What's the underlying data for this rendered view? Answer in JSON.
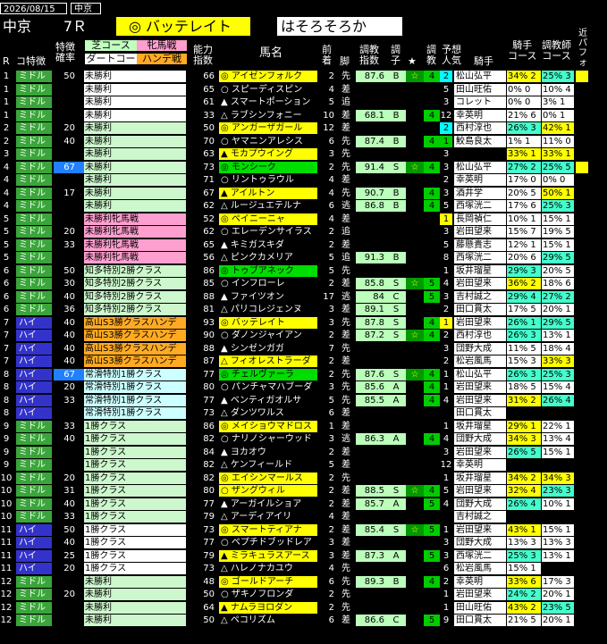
{
  "topbar": {
    "date": "2026/08/15",
    "venue": "中京"
  },
  "header": {
    "venue": "中京",
    "race": "7Ｒ",
    "pick_mark": "◎ バッテレイト",
    "comment": "はそろそろか"
  },
  "columns": {
    "r": "R",
    "dist": "コ特徴",
    "feature": "特徴\n確率",
    "turf": "芝コース",
    "dirt": "ダートコー",
    "mare": "牝馬戦",
    "hande": "ハンデ戦",
    "ability": "能力\n指数",
    "horse": "馬名",
    "prev": "前\n着",
    "leg": "脚",
    "chokyo": "調教\n指数",
    "chokyo2": "調\n子",
    "star": "★",
    "train": "調\n教",
    "pop": "予想\n人気",
    "jockey": "騎手",
    "jcourse": "騎手\nコース",
    "trcourse": "調教師\nコース",
    "recent": "近\nパ\nフ\nォ"
  },
  "rows": [
    {
      "r": "1",
      "d": "ミドル",
      "dc": "mid",
      "rat": "50",
      "cls": "未勝利",
      "cc": "w",
      "ab": "66",
      "h": "◎ アイゼンフォルク",
      "hc": "y",
      "pv": "2",
      "lg": "先",
      "ci": "87.6",
      "ck": "B",
      "star": "☆",
      "tc": "4",
      "pop": "2",
      "pc": "cy",
      "jk": "松山弘平",
      "jc": "34% 2",
      "jcc": "y",
      "tr": "25% 3",
      "trc": "c",
      "rc": "y"
    },
    {
      "r": "1",
      "d": "ミドル",
      "dc": "mid",
      "rat": "",
      "cls": "未勝利",
      "cc": "w",
      "ab": "65",
      "h": "○ スピーディスピン",
      "hc": "",
      "pv": "4",
      "lg": "差",
      "ci": "",
      "ck": "",
      "star": "",
      "tc": "",
      "pop": "5",
      "pc": "",
      "jk": "田山旺佑",
      "jc": "0% 0",
      "jcc": "w",
      "tr": "10% 4",
      "trc": "w",
      "rc": ""
    },
    {
      "r": "1",
      "d": "ミドル",
      "dc": "mid",
      "rat": "",
      "cls": "未勝利",
      "cc": "w",
      "ab": "61",
      "h": "▲ スマートポーション",
      "hc": "",
      "pv": "5",
      "lg": "追",
      "ci": "",
      "ck": "",
      "star": "",
      "tc": "",
      "pop": "3",
      "pc": "",
      "jk": "コレット",
      "jc": "0% 0",
      "jcc": "w",
      "tr": "3% 1",
      "trc": "w",
      "rc": ""
    },
    {
      "r": "1",
      "d": "ミドル",
      "dc": "mid",
      "rat": "",
      "cls": "未勝利",
      "cc": "w",
      "ab": "33",
      "h": "△ ラブシンフォニー",
      "hc": "",
      "pv": "10",
      "lg": "差",
      "ci": "68.1",
      "ck": "B",
      "star": "",
      "tc": "4",
      "pop": "12",
      "pc": "",
      "jk": "幸英明",
      "jc": "21% 6",
      "jcc": "w",
      "tr": "0% 1",
      "trc": "w",
      "rc": ""
    },
    {
      "r": "2",
      "d": "ミドル",
      "dc": "mid",
      "rat": "20",
      "cls": "未勝利",
      "cc": "g",
      "ab": "50",
      "h": "◎ アンガーザガール",
      "hc": "y",
      "pv": "12",
      "lg": "差",
      "ci": "",
      "ck": "",
      "star": "",
      "tc": "",
      "pop": "2",
      "pc": "cy",
      "jk": "西村淳也",
      "jc": "26% 3",
      "jcc": "c",
      "tr": "42% 1",
      "trc": "y",
      "rc": ""
    },
    {
      "r": "2",
      "d": "ミドル",
      "dc": "mid",
      "rat": "40",
      "cls": "未勝利",
      "cc": "g",
      "ab": "70",
      "h": "○ ヤマニンアレシス",
      "hc": "",
      "pv": "6",
      "lg": "先",
      "ci": "87.4",
      "ck": "B",
      "star": "",
      "tc": "4",
      "pop": "1",
      "pc": "gb",
      "jk": "鮫島良太",
      "jc": "1% 1",
      "jcc": "w",
      "tr": "11% 0",
      "trc": "w",
      "rc": ""
    },
    {
      "r": "3",
      "d": "ミドル",
      "dc": "mid",
      "rat": "",
      "cls": "未勝利",
      "cc": "g",
      "ab": "63",
      "h": "▲ モカプウイング",
      "hc": "y",
      "pv": "3",
      "lg": "先",
      "ci": "",
      "ck": "",
      "star": "",
      "tc": "",
      "pop": "3",
      "pc": "",
      "jk": "",
      "jc": "33% 1",
      "jcc": "y",
      "tr": "33% 1",
      "trc": "y",
      "rc": ""
    },
    {
      "r": "4",
      "d": "ミドル",
      "dc": "mid",
      "rat": "67",
      "rhl": true,
      "cls": "未勝利",
      "cc": "g",
      "ab": "73",
      "h": "◎ モンシーク",
      "hc": "g",
      "pv": "2",
      "lg": "先",
      "ci": "91.4",
      "ck": "S",
      "star": "☆",
      "tc": "4",
      "pop": "3",
      "pc": "",
      "jk": "松山弘平",
      "jc": "27% 2",
      "jcc": "c",
      "tr": "25% 5",
      "trc": "c",
      "rc": "y"
    },
    {
      "r": "4",
      "d": "ミドル",
      "dc": "mid",
      "rat": "",
      "cls": "未勝利",
      "cc": "g",
      "ab": "71",
      "h": "○ リントゥラウル",
      "hc": "",
      "pv": "4",
      "lg": "差",
      "ci": "",
      "ck": "",
      "star": "",
      "tc": "",
      "pop": "2",
      "pc": "",
      "jk": "幸英明",
      "jc": "17% 0",
      "jcc": "w",
      "tr": "0% 0",
      "trc": "w",
      "rc": ""
    },
    {
      "r": "4",
      "d": "ミドル",
      "dc": "mid",
      "rat": "17",
      "cls": "未勝利",
      "cc": "g",
      "ab": "67",
      "h": "▲ アイルトン",
      "hc": "y",
      "pv": "4",
      "lg": "先",
      "ci": "90.7",
      "ck": "B",
      "star": "",
      "tc": "4",
      "pop": "3",
      "pc": "",
      "jk": "酒井学",
      "jc": "20% 5",
      "jcc": "w",
      "tr": "50% 1",
      "trc": "y",
      "rc": ""
    },
    {
      "r": "4",
      "d": "ミドル",
      "dc": "mid",
      "rat": "",
      "cls": "未勝利",
      "cc": "g",
      "ab": "62",
      "h": "△ ルージュエテルナ",
      "hc": "",
      "pv": "6",
      "lg": "逃",
      "ci": "86.8",
      "ck": "B",
      "star": "",
      "tc": "4",
      "pop": "5",
      "pc": "",
      "jk": "西塚洸二",
      "jc": "17% 6",
      "jcc": "w",
      "tr": "25% 3",
      "trc": "c",
      "rc": ""
    },
    {
      "r": "5",
      "d": "ミドル",
      "dc": "mid",
      "rat": "",
      "cls": "未勝利牝馬戦",
      "cc": "p",
      "ab": "52",
      "h": "◎ ペイニーニャ",
      "hc": "y",
      "pv": "4",
      "lg": "差",
      "ci": "",
      "ck": "",
      "star": "",
      "tc": "",
      "pop": "1",
      "pc": "yb",
      "jk": "長岡禎仁",
      "jc": "10% 1",
      "jcc": "w",
      "tr": "15% 1",
      "trc": "w",
      "rc": ""
    },
    {
      "r": "5",
      "d": "ミドル",
      "dc": "mid",
      "rat": "20",
      "cls": "未勝利牝馬戦",
      "cc": "p",
      "ab": "62",
      "h": "○ エレーデンサイラス",
      "hc": "",
      "pv": "2",
      "lg": "追",
      "ci": "",
      "ck": "",
      "star": "",
      "tc": "",
      "pop": "3",
      "pc": "",
      "jk": "岩田望来",
      "jc": "15% 7",
      "jcc": "w",
      "tr": "19% 5",
      "trc": "w",
      "rc": ""
    },
    {
      "r": "5",
      "d": "ミドル",
      "dc": "mid",
      "rat": "33",
      "cls": "未勝利牝馬戦",
      "cc": "p",
      "ab": "65",
      "h": "▲ キミガスキダ",
      "hc": "",
      "pv": "2",
      "lg": "差",
      "ci": "",
      "ck": "",
      "star": "",
      "tc": "",
      "pop": "5",
      "pc": "",
      "jk": "藤懸貴志",
      "jc": "12% 1",
      "jcc": "w",
      "tr": "15% 1",
      "trc": "w",
      "rc": ""
    },
    {
      "r": "5",
      "d": "ミドル",
      "dc": "mid",
      "rat": "",
      "cls": "未勝利牝馬戦",
      "cc": "p",
      "ab": "56",
      "h": "△ ピンクカメリア",
      "hc": "",
      "pv": "5",
      "lg": "追",
      "ci": "91.3",
      "ck": "B",
      "star": "",
      "tc": "",
      "pop": "8",
      "pc": "",
      "jk": "西塚洸二",
      "jc": "20% 6",
      "jcc": "w",
      "tr": "29% 5",
      "trc": "c",
      "rc": ""
    },
    {
      "r": "6",
      "d": "ミドル",
      "dc": "mid",
      "rat": "50",
      "cls": "知多特別2勝クラス",
      "cc": "g",
      "ab": "86",
      "h": "◎ トゥブアネック",
      "hc": "g",
      "pv": "5",
      "lg": "先",
      "ci": "",
      "ck": "",
      "star": "",
      "tc": "",
      "pop": "1",
      "pc": "",
      "jk": "坂井瑠星",
      "jc": "29% 3",
      "jcc": "c",
      "tr": "20% 5",
      "trc": "w",
      "rc": ""
    },
    {
      "r": "6",
      "d": "ミドル",
      "dc": "mid",
      "rat": "30",
      "cls": "知多特別2勝クラス",
      "cc": "g",
      "ab": "85",
      "h": "○ インフローレ",
      "hc": "",
      "pv": "2",
      "lg": "差",
      "ci": "85.8",
      "ck": "S",
      "star": "☆",
      "tc": "5",
      "pop": "4",
      "pc": "",
      "jk": "岩田望来",
      "jc": "36% 2",
      "jcc": "y",
      "tr": "18% 6",
      "trc": "w",
      "rc": ""
    },
    {
      "r": "6",
      "d": "ミドル",
      "dc": "mid",
      "rat": "40",
      "cls": "知多特別2勝クラス",
      "cc": "g",
      "ab": "88",
      "h": "▲ ファイツオン",
      "hc": "",
      "pv": "17",
      "lg": "逃",
      "ci": "84",
      "ck": "C",
      "star": "",
      "tc": "5",
      "pop": "3",
      "pc": "",
      "jk": "吉村誠之",
      "jc": "29% 4",
      "jcc": "c",
      "tr": "27% 2",
      "trc": "c",
      "rc": ""
    },
    {
      "r": "6",
      "d": "ミドル",
      "dc": "mid",
      "rat": "36",
      "cls": "知多特別2勝クラス",
      "cc": "g",
      "ab": "81",
      "h": "△ パリコレジェンヌ",
      "hc": "",
      "pv": "3",
      "lg": "差",
      "ci": "89.1",
      "ck": "S",
      "star": "",
      "tc": "",
      "pop": "2",
      "pc": "",
      "jk": "田口貫太",
      "jc": "17% 5",
      "jcc": "w",
      "tr": "20% 1",
      "trc": "w",
      "rc": ""
    },
    {
      "r": "7",
      "d": "ハイ",
      "dc": "hi",
      "rat": "40",
      "cls": "高山S3勝クラスハンデ",
      "cc": "o",
      "ab": "93",
      "h": "◎ バッテレイト",
      "hc": "y",
      "pv": "3",
      "lg": "先",
      "ci": "87.8",
      "ck": "S",
      "star": "",
      "tc": "4",
      "pop": "1",
      "pc": "yb",
      "jk": "岩田望来",
      "jc": "26% 1",
      "jcc": "c",
      "tr": "29% 5",
      "trc": "c",
      "rc": ""
    },
    {
      "r": "7",
      "d": "ハイ",
      "dc": "hi",
      "rat": "40",
      "cls": "高山S3勝クラスハンデ",
      "cc": "o",
      "ab": "90",
      "h": "○ ダノンジャイアン",
      "hc": "",
      "pv": "2",
      "lg": "差",
      "ci": "87.2",
      "ck": "S",
      "star": "☆",
      "tc": "4",
      "pop": "2",
      "pc": "",
      "jk": "西村淳也",
      "jc": "26% 3",
      "jcc": "c",
      "tr": "13% 1",
      "trc": "w",
      "rc": ""
    },
    {
      "r": "7",
      "d": "ハイ",
      "dc": "hi",
      "rat": "40",
      "cls": "高山S3勝クラスハンデ",
      "cc": "o",
      "ab": "88",
      "h": "▲ シンゼンガガ",
      "hc": "",
      "pv": "7",
      "lg": "先",
      "ci": "",
      "ck": "",
      "star": "",
      "tc": "",
      "pop": "3",
      "pc": "",
      "jk": "団野大成",
      "jc": "11% 5",
      "jcc": "w",
      "tr": "18% 4",
      "trc": "w",
      "rc": ""
    },
    {
      "r": "7",
      "d": "ハイ",
      "dc": "hi",
      "rat": "40",
      "cls": "高山S3勝クラスハンデ",
      "cc": "o",
      "ab": "87",
      "h": "△ フィオレストラーダ",
      "hc": "y",
      "pv": "2",
      "lg": "差",
      "ci": "",
      "ck": "",
      "star": "",
      "tc": "",
      "pop": "2",
      "pc": "",
      "jk": "松岩風馬",
      "jc": "15% 3",
      "jcc": "w",
      "tr": "33% 3",
      "trc": "y",
      "rc": ""
    },
    {
      "r": "8",
      "d": "ハイ",
      "dc": "hi",
      "rat": "67",
      "rhl": true,
      "cls": "常滑特別1勝クラス",
      "cc": "b",
      "ab": "77",
      "h": "◎ チェルヴァーラ",
      "hc": "g",
      "pv": "2",
      "lg": "先",
      "ci": "87.6",
      "ck": "S",
      "star": "☆",
      "tc": "4",
      "pop": "1",
      "pc": "",
      "jk": "松山弘平",
      "jc": "26% 3",
      "jcc": "c",
      "tr": "25% 3",
      "trc": "c",
      "rc": ""
    },
    {
      "r": "8",
      "d": "ハイ",
      "dc": "hi",
      "rat": "20",
      "cls": "常滑特別1勝クラス",
      "cc": "b",
      "ab": "80",
      "h": "○ パンチャマハブーダ",
      "hc": "",
      "pv": "3",
      "lg": "先",
      "ci": "85.6",
      "ck": "A",
      "star": "",
      "tc": "4",
      "pop": "1",
      "pc": "",
      "jk": "岩田望来",
      "jc": "18% 5",
      "jcc": "w",
      "tr": "15% 4",
      "trc": "w",
      "rc": ""
    },
    {
      "r": "8",
      "d": "ハイ",
      "dc": "hi",
      "rat": "33",
      "cls": "常滑特別1勝クラス",
      "cc": "b",
      "ab": "77",
      "h": "▲ ベンティガオルサ",
      "hc": "",
      "pv": "5",
      "lg": "先",
      "ci": "85.5",
      "ck": "A",
      "star": "",
      "tc": "4",
      "pop": "4",
      "pc": "",
      "jk": "岩田望来",
      "jc": "31% 2",
      "jcc": "y",
      "tr": "26% 4",
      "trc": "c",
      "rc": ""
    },
    {
      "r": "8",
      "d": "ハイ",
      "dc": "hi",
      "rat": "",
      "cls": "常滑特別1勝クラス",
      "cc": "b",
      "ab": "73",
      "h": "△ ダンツワルス",
      "hc": "",
      "pv": "6",
      "lg": "差",
      "ci": "",
      "ck": "",
      "star": "",
      "tc": "",
      "pop": "",
      "pc": "",
      "jk": "田口貫太",
      "jc": "",
      "jcc": "w",
      "tr": "",
      "trc": "w",
      "rc": ""
    },
    {
      "r": "9",
      "d": "ミドル",
      "dc": "mid",
      "rat": "33",
      "cls": "1勝クラス",
      "cc": "g",
      "ab": "86",
      "h": "◎ メイショウマドロス",
      "hc": "y",
      "pv": "1",
      "lg": "差",
      "ci": "",
      "ck": "",
      "star": "",
      "tc": "",
      "pop": "1",
      "pc": "",
      "jk": "坂井瑠星",
      "jc": "29% 1",
      "jcc": "y",
      "tr": "22% 1",
      "trc": "w",
      "rc": ""
    },
    {
      "r": "9",
      "d": "ミドル",
      "dc": "mid",
      "rat": "40",
      "cls": "1勝クラス",
      "cc": "g",
      "ab": "82",
      "h": "○ ナリノシャーウッド",
      "hc": "",
      "pv": "3",
      "lg": "逃",
      "ci": "86.3",
      "ck": "A",
      "star": "",
      "tc": "4",
      "pop": "4",
      "pc": "",
      "jk": "団野大成",
      "jc": "34% 3",
      "jcc": "y",
      "tr": "13% 4",
      "trc": "w",
      "rc": ""
    },
    {
      "r": "9",
      "d": "ミドル",
      "dc": "mid",
      "rat": "",
      "cls": "1勝クラス",
      "cc": "g",
      "ab": "84",
      "h": "▲ ヨカオウ",
      "hc": "",
      "pv": "2",
      "lg": "差",
      "ci": "",
      "ck": "",
      "star": "",
      "tc": "",
      "pop": "3",
      "pc": "",
      "jk": "岩田望来",
      "jc": "26% 5",
      "jcc": "c",
      "tr": "15% 1",
      "trc": "w",
      "rc": ""
    },
    {
      "r": "9",
      "d": "ミドル",
      "dc": "mid",
      "rat": "",
      "cls": "1勝クラス",
      "cc": "g",
      "ab": "82",
      "h": "△ ケンフィールド",
      "hc": "",
      "pv": "5",
      "lg": "差",
      "ci": "",
      "ck": "",
      "star": "",
      "tc": "",
      "pop": "12",
      "pc": "",
      "jk": "幸英明",
      "jc": "",
      "jcc": "w",
      "tr": "",
      "trc": "w",
      "rc": ""
    },
    {
      "r": "10",
      "d": "ミドル",
      "dc": "mid",
      "rat": "20",
      "cls": "1勝クラス",
      "cc": "g",
      "ab": "82",
      "h": "◎ エイシンマールス",
      "hc": "y",
      "pv": "2",
      "lg": "先",
      "ci": "",
      "ck": "",
      "star": "",
      "tc": "",
      "pop": "1",
      "pc": "",
      "jk": "坂井瑠星",
      "jc": "34% 2",
      "jcc": "y",
      "tr": "34% 3",
      "trc": "y",
      "rc": ""
    },
    {
      "r": "10",
      "d": "ミドル",
      "dc": "mid",
      "rat": "31",
      "cls": "1勝クラス",
      "cc": "g",
      "ab": "80",
      "h": "○ ザングウィル",
      "hc": "y",
      "pv": "2",
      "lg": "差",
      "ci": "88.5",
      "ck": "S",
      "star": "☆",
      "tc": "4",
      "pop": "5",
      "pc": "",
      "jk": "岩田望来",
      "jc": "32% 4",
      "jcc": "y",
      "tr": "23% 3",
      "trc": "c",
      "rc": ""
    },
    {
      "r": "10",
      "d": "ミドル",
      "dc": "mid",
      "rat": "40",
      "cls": "1勝クラス",
      "cc": "g",
      "ab": "77",
      "h": "▲ アーガイルショア",
      "hc": "",
      "pv": "2",
      "lg": "差",
      "ci": "85.7",
      "ck": "A",
      "star": "",
      "tc": "5",
      "pop": "4",
      "pc": "",
      "jk": "団野大成",
      "jc": "26% 4",
      "jcc": "c",
      "tr": "10% 1",
      "trc": "w",
      "rc": ""
    },
    {
      "r": "10",
      "d": "ミドル",
      "dc": "mid",
      "rat": "33",
      "cls": "1勝クラス",
      "cc": "g",
      "ab": "79",
      "h": "△ アーディアイリ",
      "hc": "",
      "pv": "4",
      "lg": "差",
      "ci": "",
      "ck": "",
      "star": "",
      "tc": "",
      "pop": "",
      "pc": "",
      "jk": "吉村誠之",
      "jc": "",
      "jcc": "w",
      "tr": "",
      "trc": "w",
      "rc": ""
    },
    {
      "r": "11",
      "d": "ハイ",
      "dc": "hi",
      "rat": "50",
      "cls": "1勝クラス",
      "cc": "w",
      "ab": "73",
      "h": "◎ スマートティアナ",
      "hc": "y",
      "pv": "2",
      "lg": "差",
      "ci": "85.4",
      "ck": "S",
      "star": "☆",
      "tc": "5",
      "pop": "1",
      "pc": "",
      "jk": "岩田望来",
      "jc": "43% 1",
      "jcc": "y",
      "tr": "15% 1",
      "trc": "w",
      "rc": ""
    },
    {
      "r": "11",
      "d": "ハイ",
      "dc": "hi",
      "rat": "40",
      "cls": "1勝クラス",
      "cc": "w",
      "ab": "77",
      "h": "○ ペプチドブッドレア",
      "hc": "",
      "pv": "3",
      "lg": "差",
      "ci": "",
      "ck": "",
      "star": "",
      "tc": "",
      "pop": "3",
      "pc": "",
      "jk": "団野大成",
      "jc": "13% 3",
      "jcc": "w",
      "tr": "13% 3",
      "trc": "w",
      "rc": ""
    },
    {
      "r": "11",
      "d": "ハイ",
      "dc": "hi",
      "rat": "25",
      "cls": "1勝クラス",
      "cc": "w",
      "ab": "79",
      "h": "▲ ミラキュラスアース",
      "hc": "y",
      "pv": "3",
      "lg": "差",
      "ci": "87.3",
      "ck": "A",
      "star": "",
      "tc": "5",
      "pop": "3",
      "pc": "",
      "jk": "西塚洸二",
      "jc": "25% 3",
      "jcc": "c",
      "tr": "13% 1",
      "trc": "w",
      "rc": ""
    },
    {
      "r": "11",
      "d": "ハイ",
      "dc": "hi",
      "rat": "20",
      "cls": "1勝クラス",
      "cc": "w",
      "ab": "73",
      "h": "△ ハレノナカユウ",
      "hc": "",
      "pv": "4",
      "lg": "先",
      "ci": "",
      "ck": "",
      "star": "",
      "tc": "",
      "pop": "6",
      "pc": "",
      "jk": "松岩風馬",
      "jc": "15% 1",
      "jcc": "w",
      "tr": "",
      "trc": "w",
      "rc": ""
    },
    {
      "r": "12",
      "d": "ミドル",
      "dc": "mid",
      "rat": "",
      "cls": "未勝利",
      "cc": "g",
      "ab": "48",
      "h": "◎ ゴールドアーチ",
      "hc": "y",
      "pv": "6",
      "lg": "先",
      "ci": "89.3",
      "ck": "B",
      "star": "",
      "tc": "4",
      "pop": "2",
      "pc": "",
      "jk": "幸英明",
      "jc": "33% 6",
      "jcc": "y",
      "tr": "17% 3",
      "trc": "w",
      "rc": ""
    },
    {
      "r": "12",
      "d": "ミドル",
      "dc": "mid",
      "rat": "20",
      "cls": "未勝利",
      "cc": "g",
      "ab": "50",
      "h": "○ ザキノフロンダ",
      "hc": "",
      "pv": "2",
      "lg": "先",
      "ci": "",
      "ck": "",
      "star": "",
      "tc": "",
      "pop": "1",
      "pc": "",
      "jk": "岩田望来",
      "jc": "24% 2",
      "jcc": "c",
      "tr": "20% 1",
      "trc": "w",
      "rc": ""
    },
    {
      "r": "12",
      "d": "ミドル",
      "dc": "mid",
      "rat": "",
      "cls": "未勝利",
      "cc": "g",
      "ab": "64",
      "h": "▲ ナムラヨロダン",
      "hc": "y",
      "pv": "2",
      "lg": "先",
      "ci": "",
      "ck": "",
      "star": "",
      "tc": "",
      "pop": "1",
      "pc": "",
      "jk": "田山旺佑",
      "jc": "43% 2",
      "jcc": "y",
      "tr": "23% 5",
      "trc": "c",
      "rc": ""
    },
    {
      "r": "12",
      "d": "ミドル",
      "dc": "mid",
      "rat": "",
      "cls": "未勝利",
      "cc": "g",
      "ab": "50",
      "h": "△ ペコリズム",
      "hc": "",
      "pv": "6",
      "lg": "差",
      "ci": "86.6",
      "ck": "C",
      "star": "",
      "tc": "5",
      "pop": "9",
      "pc": "",
      "jk": "田口貫太",
      "jc": "21% 5",
      "jcc": "w",
      "tr": "20% 1",
      "trc": "w",
      "rc": ""
    }
  ]
}
